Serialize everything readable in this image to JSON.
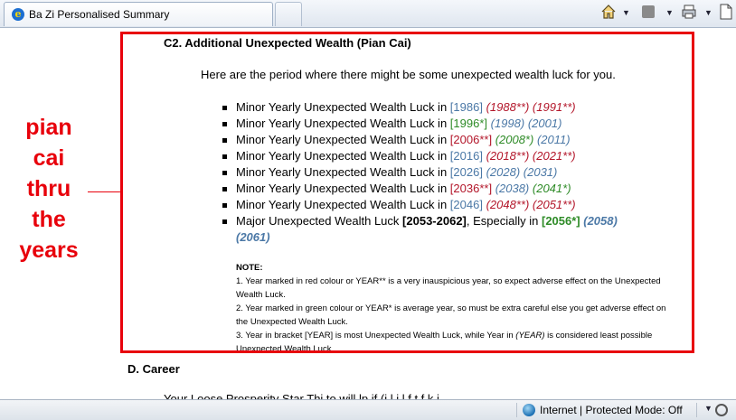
{
  "browser": {
    "tab_title": "Ba Zi Personalised Summary",
    "feed_icon": "feed-icon",
    "home_icon": "home-icon",
    "print_icon": "print-icon",
    "page_icon": "page-icon"
  },
  "section": {
    "title": "C2. Additional Unexpected Wealth (Pian Cai)",
    "intro": "Here are the period where there might be some unexpected wealth luck for you."
  },
  "luck_items": [
    {
      "prefix": "Minor Yearly Unexpected Wealth Luck in",
      "main": "[1986]",
      "main_style": "blue",
      "extra": [
        {
          "t": "(1988**)",
          "s": "red"
        },
        {
          "t": "(1991**)",
          "s": "red"
        }
      ]
    },
    {
      "prefix": "Minor Yearly Unexpected Wealth Luck in",
      "main": "[1996*]",
      "main_style": "green-br",
      "extra": [
        {
          "t": "(1998)",
          "s": "blue-it"
        },
        {
          "t": "(2001)",
          "s": "blue-it"
        }
      ]
    },
    {
      "prefix": "Minor Yearly Unexpected Wealth Luck in",
      "main": "[2006**]",
      "main_style": "red-br",
      "extra": [
        {
          "t": "(2008*)",
          "s": "green-it"
        },
        {
          "t": "(2011)",
          "s": "blue-it"
        }
      ]
    },
    {
      "prefix": "Minor Yearly Unexpected Wealth Luck in",
      "main": "[2016]",
      "main_style": "blue",
      "extra": [
        {
          "t": "(2018**)",
          "s": "red"
        },
        {
          "t": "(2021**)",
          "s": "red"
        }
      ]
    },
    {
      "prefix": "Minor Yearly Unexpected Wealth Luck in",
      "main": "[2026]",
      "main_style": "blue",
      "extra": [
        {
          "t": "(2028)",
          "s": "blue-it"
        },
        {
          "t": "(2031)",
          "s": "blue-it"
        }
      ]
    },
    {
      "prefix": "Minor Yearly Unexpected Wealth Luck in",
      "main": "[2036**]",
      "main_style": "red-br",
      "extra": [
        {
          "t": "(2038)",
          "s": "blue-it"
        },
        {
          "t": "(2041*)",
          "s": "green-it"
        }
      ]
    },
    {
      "prefix": "Minor Yearly Unexpected Wealth Luck in",
      "main": "[2046]",
      "main_style": "blue",
      "extra": [
        {
          "t": "(2048**)",
          "s": "red"
        },
        {
          "t": "(2051**)",
          "s": "red"
        }
      ]
    }
  ],
  "major_item": {
    "prefix": "Major Unexpected Wealth Luck",
    "range": "[2053-2062]",
    "mid": ", Especially in",
    "year": "[2056*]",
    "extra1": "(2058)",
    "extra2": "(2061)"
  },
  "note": {
    "head": "NOTE:",
    "line1": "1. Year marked in red colour or YEAR** is a very inauspicious year, so expect adverse effect on the Unexpected Wealth Luck.",
    "line2": "2. Year marked in green colour or YEAR* is average year, so must be extra careful else you get adverse effect on the Unexpected Wealth Luck.",
    "line3a": "3. Year in bracket [YEAR] is most Unexpected Wealth Luck, while Year in",
    "line3b": "(YEAR)",
    "line3c": "is considered least possible Unexpected Wealth Luck."
  },
  "annotation": {
    "lines": [
      "pian",
      "cai",
      "thru",
      "the",
      "years"
    ]
  },
  "next_section": {
    "title": "D. Career",
    "cut_text": "Your Loose Prosperity Star Thi    to will     lp    if              (i  l   i  l   f    t    f   k i"
  },
  "statusbar": {
    "zone_text": "Internet | Protected Mode: Off"
  },
  "colors": {
    "highlight": "#e8000b",
    "blue": "#4b78a6",
    "red": "#b3162a",
    "green": "#2e8b27"
  }
}
